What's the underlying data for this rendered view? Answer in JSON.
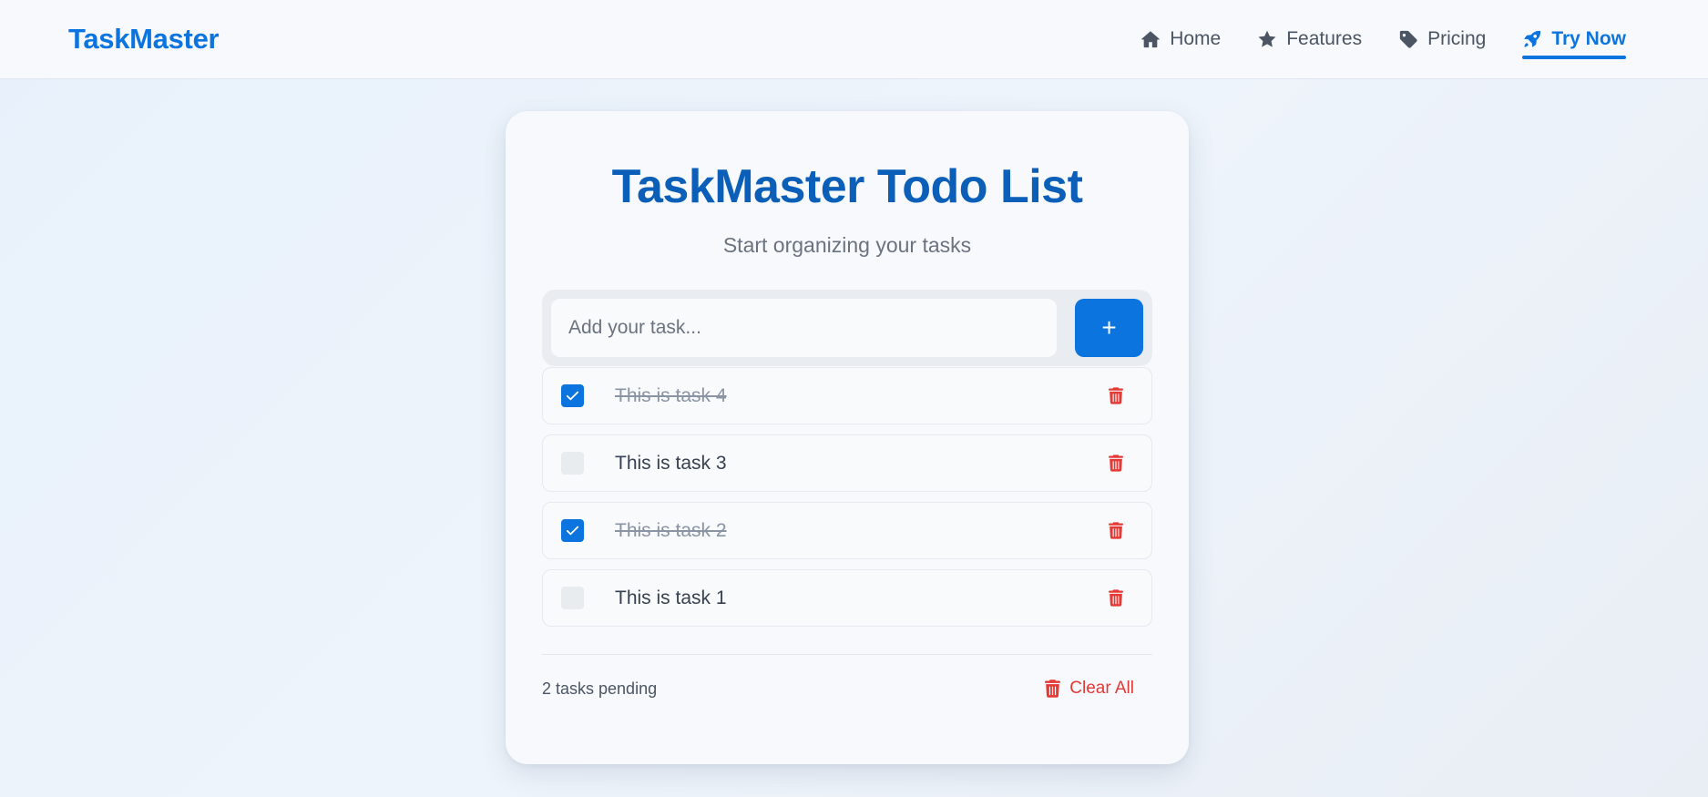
{
  "brand": "TaskMaster",
  "nav": [
    {
      "label": "Home",
      "icon": "home-icon",
      "active": false
    },
    {
      "label": "Features",
      "icon": "star-icon",
      "active": false
    },
    {
      "label": "Pricing",
      "icon": "tag-icon",
      "active": false
    },
    {
      "label": "Try Now",
      "icon": "rocket-icon",
      "active": true
    }
  ],
  "card": {
    "title": "TaskMaster Todo List",
    "subtitle": "Start organizing your tasks",
    "input_placeholder": "Add your task...",
    "input_value": "",
    "add_button_label": "+"
  },
  "tasks": [
    {
      "text": "This is task 4",
      "done": true
    },
    {
      "text": "This is task 3",
      "done": false
    },
    {
      "text": "This is task 2",
      "done": true
    },
    {
      "text": "This is task 1",
      "done": false
    }
  ],
  "footer": {
    "pending_text": "2 tasks pending",
    "clear_label": "Clear All"
  },
  "colors": {
    "accent": "#0b74de",
    "title": "#0b5fb8",
    "danger": "#e53935"
  }
}
